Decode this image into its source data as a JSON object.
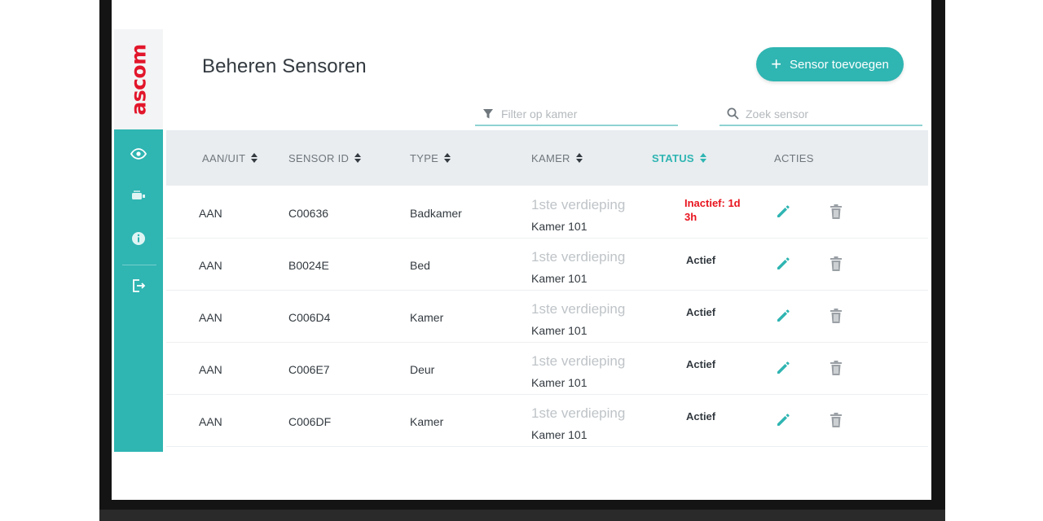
{
  "brand": {
    "logo_text": "ascom",
    "logo_color": "#e2162b",
    "accent": "#2fb5b2"
  },
  "sidebar": {
    "items": [
      {
        "icon": "eye-icon"
      },
      {
        "icon": "sensor-icon"
      },
      {
        "icon": "info-icon"
      },
      {
        "icon": "logout-icon"
      }
    ]
  },
  "header": {
    "title": "Beheren Sensoren",
    "add_button_icon": "+",
    "add_button_label": "Sensor toevoegen"
  },
  "filters": {
    "room_filter_placeholder": "Filter op kamer",
    "search_placeholder": "Zoek sensor"
  },
  "table": {
    "columns": [
      {
        "label": "AAN/UIT",
        "sortable": true,
        "active": false
      },
      {
        "label": "SENSOR ID",
        "sortable": true,
        "active": false
      },
      {
        "label": "TYPE",
        "sortable": true,
        "active": false
      },
      {
        "label": "KAMER",
        "sortable": true,
        "active": false
      },
      {
        "label": "STATUS",
        "sortable": true,
        "active": true
      },
      {
        "label": "ACTIES",
        "sortable": false,
        "active": false
      }
    ],
    "rows": [
      {
        "power": "AAN",
        "sensor_id": "C00636",
        "type": "Badkamer",
        "floor": "1ste verdieping",
        "room": "Kamer 101",
        "status": "Inactief: 1d 3h",
        "status_kind": "inactive"
      },
      {
        "power": "AAN",
        "sensor_id": "B0024E",
        "type": "Bed",
        "floor": "1ste verdieping",
        "room": "Kamer 101",
        "status": "Actief",
        "status_kind": "active"
      },
      {
        "power": "AAN",
        "sensor_id": "C006D4",
        "type": "Kamer",
        "floor": "1ste verdieping",
        "room": "Kamer 101",
        "status": "Actief",
        "status_kind": "active"
      },
      {
        "power": "AAN",
        "sensor_id": "C006E7",
        "type": "Deur",
        "floor": "1ste verdieping",
        "room": "Kamer 101",
        "status": "Actief",
        "status_kind": "active"
      },
      {
        "power": "AAN",
        "sensor_id": "C006DF",
        "type": "Kamer",
        "floor": "1ste verdieping",
        "room": "Kamer 101",
        "status": "Actief",
        "status_kind": "active"
      }
    ]
  }
}
